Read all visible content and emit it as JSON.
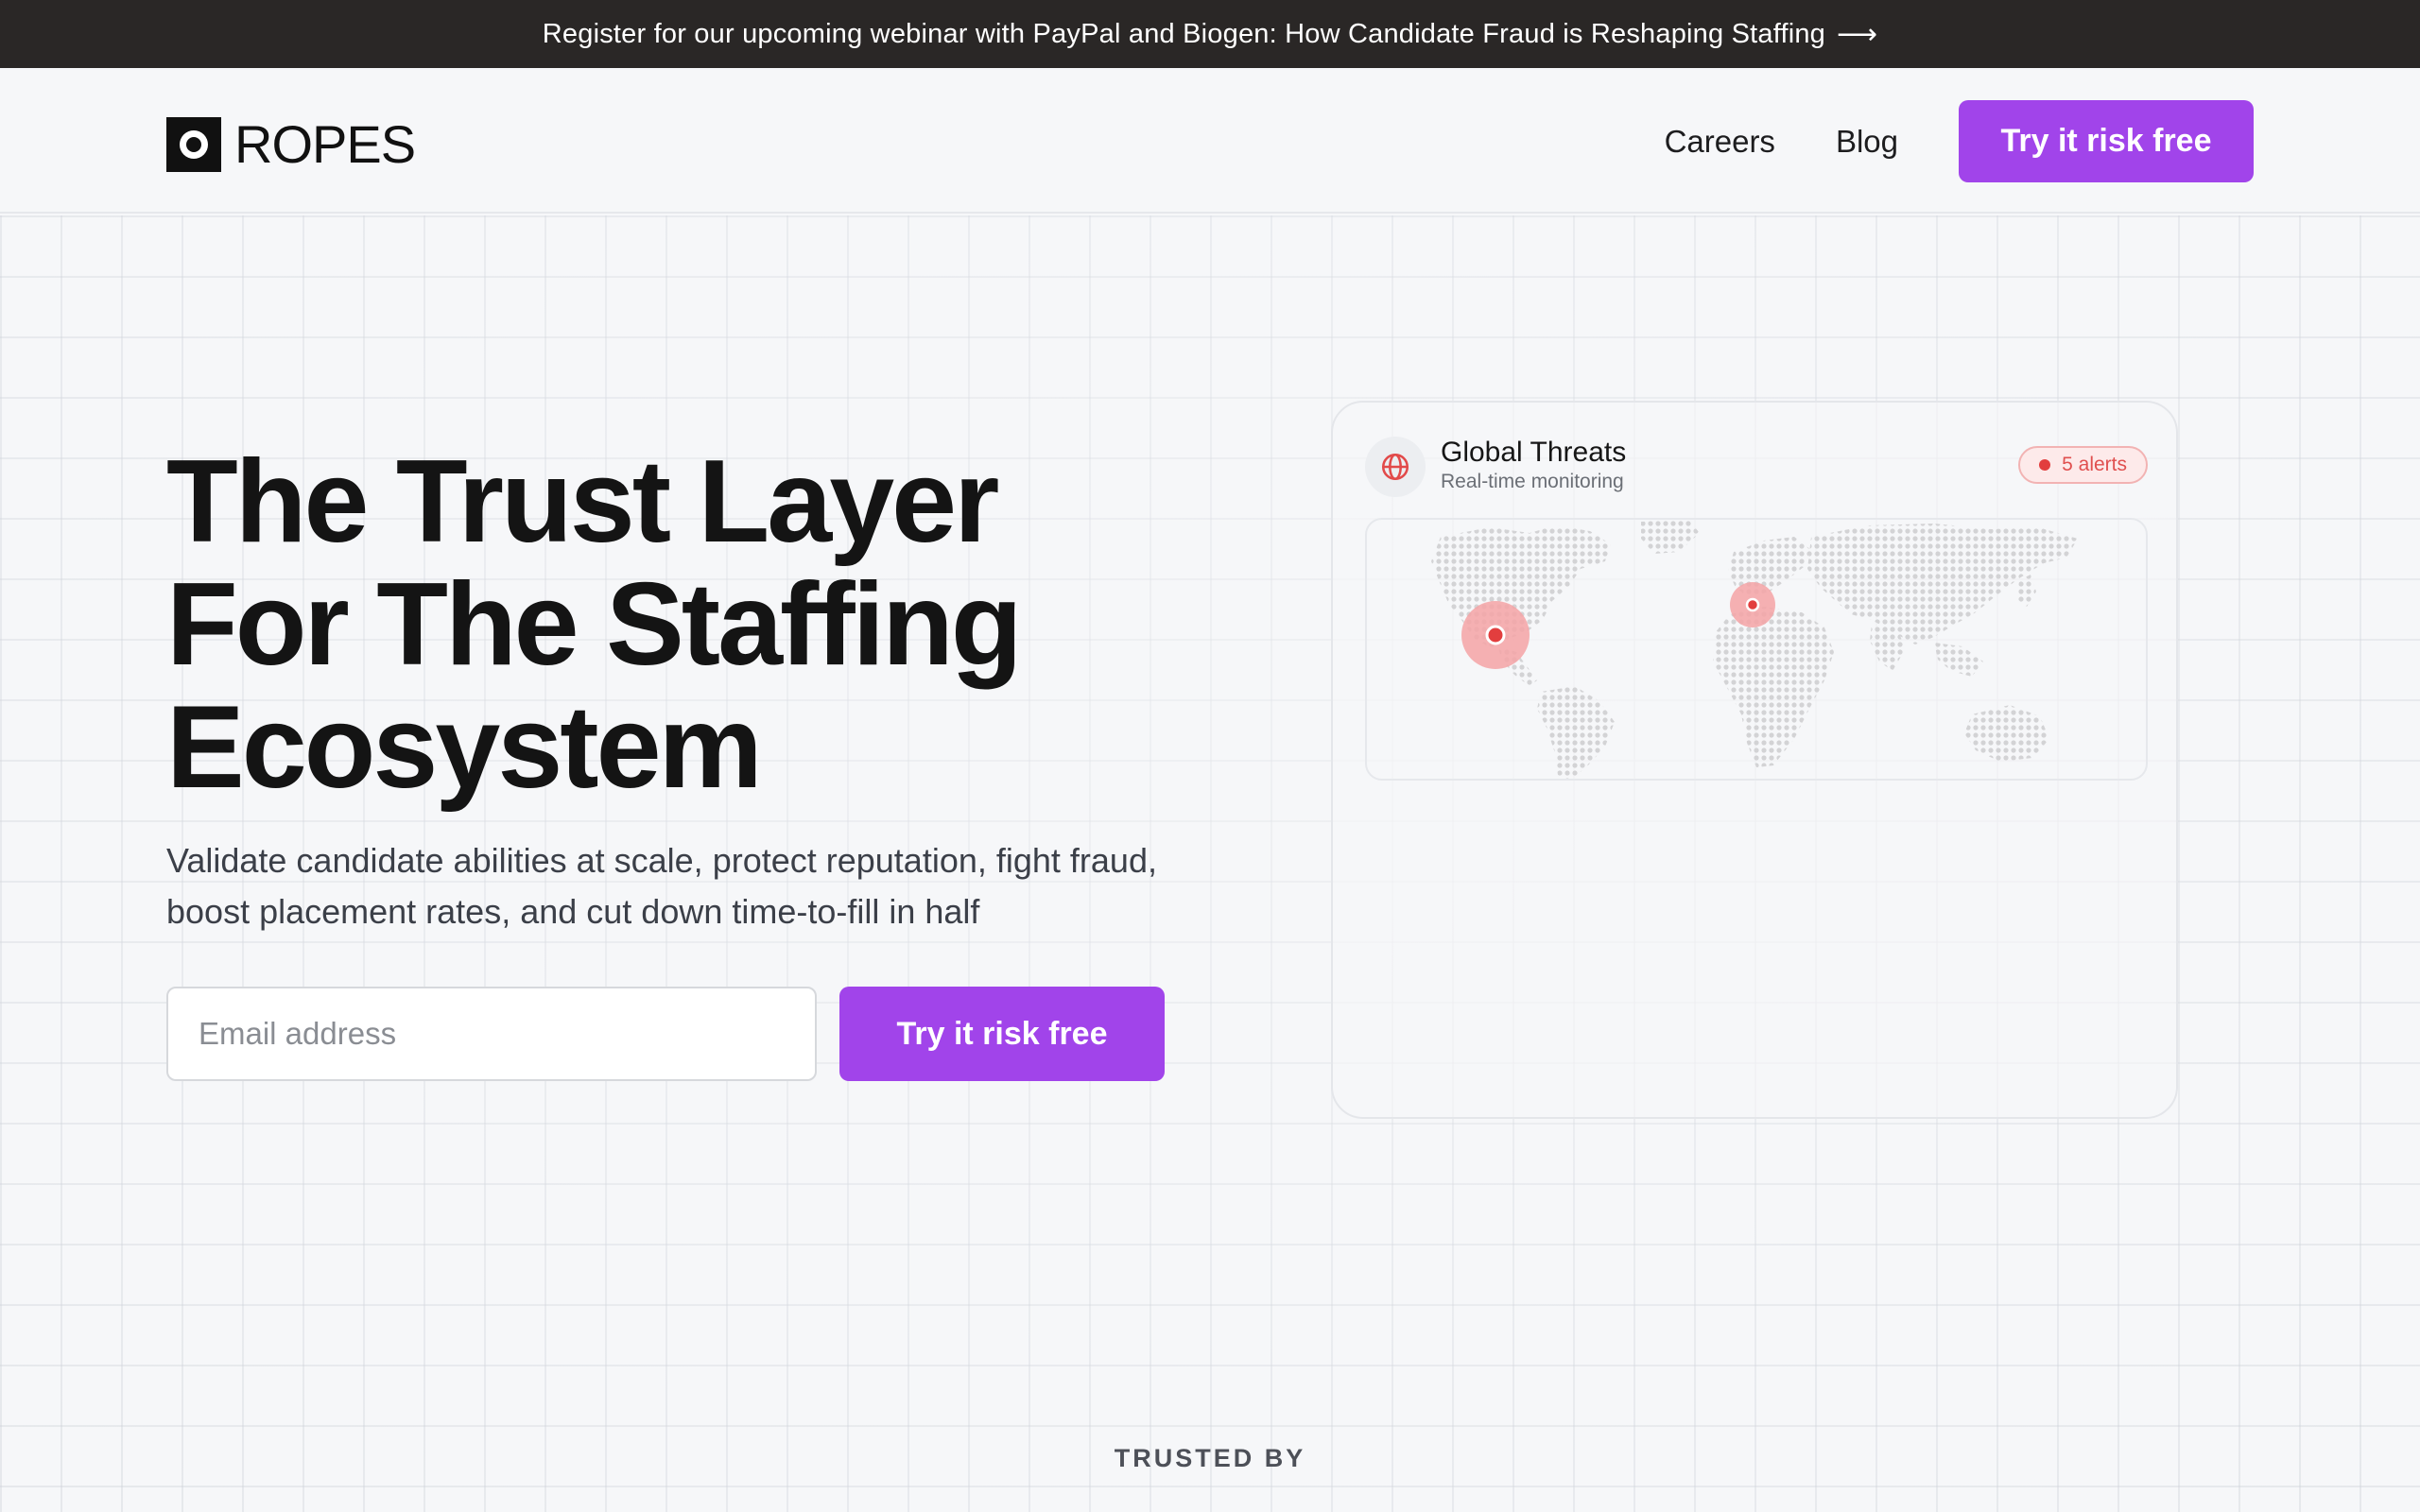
{
  "banner": {
    "text": "Register for our upcoming webinar with PayPal and Biogen: How Candidate Fraud is Reshaping Staffing",
    "arrow": "⟶"
  },
  "header": {
    "logo_text": "ROPES",
    "nav": [
      {
        "label": "Careers"
      },
      {
        "label": "Blog"
      }
    ],
    "cta_label": "Try it risk free"
  },
  "hero": {
    "headline_lines": [
      "The Trust Layer",
      "For The Staffing",
      "Ecosystem"
    ],
    "subtext": "Validate candidate abilities at scale, protect reputation, fight fraud, boost placement rates, and cut down time-to-fill in half",
    "email_placeholder": "Email address",
    "cta_label": "Try it risk free"
  },
  "threat_card": {
    "title": "Global Threats",
    "subtitle": "Real-time monitoring",
    "alerts_label": "5 alerts",
    "icon": "globe-icon",
    "map_icon": "world-map"
  },
  "trusted_label": "TRUSTED BY",
  "colors": {
    "accent": "#a144ea",
    "banner_bg": "#2a2726",
    "alert": "#e23e3e"
  }
}
